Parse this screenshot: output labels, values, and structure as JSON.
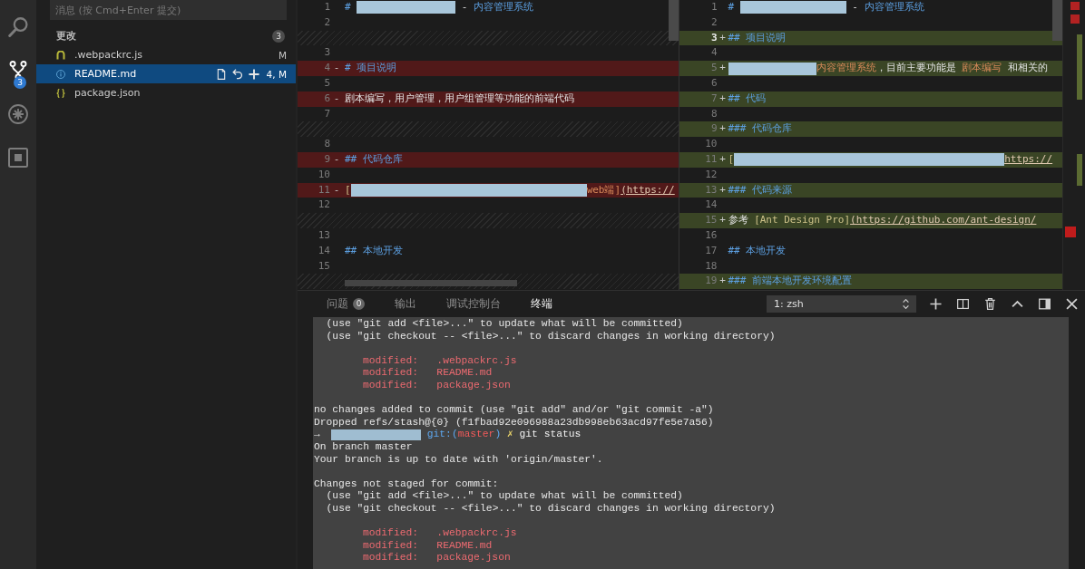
{
  "activity_bar": {
    "items": [
      {
        "kind": "search",
        "selected": false
      },
      {
        "kind": "source_control",
        "selected": true,
        "badge": "3"
      },
      {
        "kind": "debug",
        "selected": false
      },
      {
        "kind": "extensions",
        "selected": false
      }
    ]
  },
  "source_control": {
    "message_input": {
      "placeholder": "消息 (按 Cmd+Enter 提交)"
    },
    "changes": {
      "title": "更改",
      "count": "3",
      "files": [
        {
          "kind": "js",
          "name": ".webpackrc.js",
          "status": "M",
          "selected": false
        },
        {
          "kind": "info",
          "name": "README.md",
          "status": "4, M",
          "selected": true
        },
        {
          "kind": "json",
          "name": "package.json",
          "selected": false
        }
      ]
    }
  },
  "diff": {
    "original": {
      "rows": [
        {
          "kind": "normal",
          "number": "1",
          "segments": [
            {
              "kind": "heading",
              "text": "# "
            },
            {
              "kind": "redacted"
            },
            {
              "kind": "text",
              "text": " - "
            },
            {
              "kind": "heading",
              "text": "内容管理系统"
            }
          ]
        },
        {
          "kind": "normal",
          "number": "2"
        },
        {
          "kind": "filler"
        },
        {
          "kind": "normal",
          "number": "3"
        },
        {
          "kind": "removed",
          "number": "4",
          "marker": "-",
          "segments": [
            {
              "kind": "heading",
              "text": "# 项目说明"
            }
          ]
        },
        {
          "kind": "normal",
          "number": "5"
        },
        {
          "kind": "removed",
          "number": "6",
          "marker": "-",
          "segments": [
            {
              "kind": "text",
              "text": "剧本编写，用户管理，用户组管理等功能的前端代码"
            }
          ]
        },
        {
          "kind": "normal",
          "number": "7"
        },
        {
          "kind": "filler"
        },
        {
          "kind": "normal",
          "number": "8"
        },
        {
          "kind": "removed",
          "number": "9",
          "marker": "-",
          "segments": [
            {
              "kind": "heading",
              "text": "## 代码仓库"
            }
          ]
        },
        {
          "kind": "normal",
          "number": "10"
        },
        {
          "kind": "removed",
          "number": "11",
          "marker": "-",
          "segments": [
            {
              "kind": "link_text",
              "text": "["
            },
            {
              "kind": "redacted"
            },
            {
              "kind": "emph",
              "text": "web端]"
            },
            {
              "kind": "url",
              "text": "(https://"
            }
          ]
        },
        {
          "kind": "normal",
          "number": "12"
        },
        {
          "kind": "filler"
        },
        {
          "kind": "normal",
          "number": "13"
        },
        {
          "kind": "normal",
          "number": "14",
          "segments": [
            {
              "kind": "heading",
              "text": "## 本地开发"
            }
          ]
        },
        {
          "kind": "normal",
          "number": "15"
        },
        {
          "kind": "filler"
        }
      ]
    },
    "modified": {
      "rows": [
        {
          "kind": "normal",
          "number": "1",
          "current": false,
          "segments": [
            {
              "kind": "heading",
              "text": "# "
            },
            {
              "kind": "redacted"
            },
            {
              "kind": "text",
              "text": " - "
            },
            {
              "kind": "heading",
              "text": "内容管理系统"
            }
          ]
        },
        {
          "kind": "normal",
          "number": "2",
          "current": false
        },
        {
          "kind": "added",
          "number": "3",
          "current": true,
          "marker": "+",
          "segments": [
            {
              "kind": "heading",
              "text": "## 项目说明"
            }
          ]
        },
        {
          "kind": "normal",
          "number": "4",
          "current": false
        },
        {
          "kind": "added",
          "number": "5",
          "current": false,
          "marker": "+",
          "segments": [
            {
              "kind": "redacted"
            },
            {
              "kind": "emph",
              "text": "内容管理系统"
            },
            {
              "kind": "text",
              "text": "，目前主要功能是 "
            },
            {
              "kind": "emph",
              "text": "剧本编写"
            },
            {
              "kind": "text",
              "text": " 和相关的"
            }
          ]
        },
        {
          "kind": "normal",
          "number": "6",
          "current": false
        },
        {
          "kind": "added",
          "number": "7",
          "current": false,
          "marker": "+",
          "segments": [
            {
              "kind": "heading",
              "text": "## 代码"
            }
          ]
        },
        {
          "kind": "normal",
          "number": "8",
          "current": false
        },
        {
          "kind": "added",
          "number": "9",
          "current": false,
          "marker": "+",
          "segments": [
            {
              "kind": "heading",
              "text": "### 代码仓库"
            }
          ]
        },
        {
          "kind": "normal",
          "number": "10",
          "current": false
        },
        {
          "kind": "added",
          "number": "11",
          "current": false,
          "marker": "+",
          "segments": [
            {
              "kind": "link_text",
              "text": "["
            },
            {
              "kind": "redacted"
            },
            {
              "kind": "url",
              "text": "https://"
            }
          ]
        },
        {
          "kind": "normal",
          "number": "12",
          "current": false
        },
        {
          "kind": "added",
          "number": "13",
          "current": false,
          "marker": "+",
          "segments": [
            {
              "kind": "heading",
              "text": "### 代码来源"
            }
          ]
        },
        {
          "kind": "normal",
          "number": "14",
          "current": false
        },
        {
          "kind": "added",
          "number": "15",
          "current": false,
          "marker": "+",
          "segments": [
            {
              "kind": "text",
              "text": "参考 "
            },
            {
              "kind": "link_text",
              "text": "[Ant Design Pro]"
            },
            {
              "kind": "url",
              "text": "(https://github.com/ant-design/"
            }
          ]
        },
        {
          "kind": "normal",
          "number": "16",
          "current": false
        },
        {
          "kind": "normal",
          "number": "17",
          "current": false,
          "segments": [
            {
              "kind": "heading",
              "text": "## 本地开发"
            }
          ]
        },
        {
          "kind": "normal",
          "number": "18",
          "current": false
        },
        {
          "kind": "added",
          "number": "19",
          "current": false,
          "marker": "+",
          "segments": [
            {
              "kind": "heading",
              "text": "### 前端本地开发环境配置"
            }
          ]
        }
      ]
    }
  },
  "panel": {
    "tabs": [
      {
        "label": "问题",
        "badge": "0",
        "selected": false
      },
      {
        "label": "输出",
        "selected": false
      },
      {
        "label": "调试控制台",
        "selected": false
      },
      {
        "label": "终端",
        "selected": true
      }
    ],
    "terminal_select": "1: zsh",
    "terminal_lines": [
      {
        "kind": "hint",
        "text": "(use \"git add <file>...\" to update what will be committed)"
      },
      {
        "kind": "hint",
        "text": "(use \"git checkout -- <file>...\" to discard changes in working directory)"
      },
      {
        "kind": "blank"
      },
      {
        "kind": "modified",
        "text": "modified:   .webpackrc.js"
      },
      {
        "kind": "modified",
        "text": "modified:   README.md"
      },
      {
        "kind": "modified",
        "text": "modified:   package.json"
      },
      {
        "kind": "blank"
      },
      {
        "kind": "plain",
        "text": "no changes added to commit (use \"git add\" and/or \"git commit -a\")"
      },
      {
        "kind": "plain",
        "text": "Dropped refs/stash@{0} (f1fbad92e096988a23db998eb63acd97fe5e7a56)"
      },
      {
        "kind": "prompt",
        "segments": [
          {
            "kind": "symbol",
            "text": "→"
          },
          {
            "kind": "redacted"
          },
          {
            "kind": "git",
            "text": "git:("
          },
          {
            "kind": "branch",
            "text": "master"
          },
          {
            "kind": "git",
            "text": ")"
          },
          {
            "kind": "dirty",
            "text": " ✗"
          },
          {
            "kind": "command",
            "text": " git status"
          }
        ]
      },
      {
        "kind": "plain",
        "text": "On branch master"
      },
      {
        "kind": "plain",
        "text": "Your branch is up to date with 'origin/master'."
      },
      {
        "kind": "blank"
      },
      {
        "kind": "plain",
        "text": "Changes not staged for commit:"
      },
      {
        "kind": "hint",
        "text": "(use \"git add <file>...\" to update what will be committed)"
      },
      {
        "kind": "hint",
        "text": "(use \"git checkout -- <file>...\" to discard changes in working directory)"
      },
      {
        "kind": "blank"
      },
      {
        "kind": "modified",
        "text": "modified:   .webpackrc.js"
      },
      {
        "kind": "modified",
        "text": "modified:   README.md"
      },
      {
        "kind": "modified",
        "text": "modified:   package.json"
      }
    ]
  }
}
